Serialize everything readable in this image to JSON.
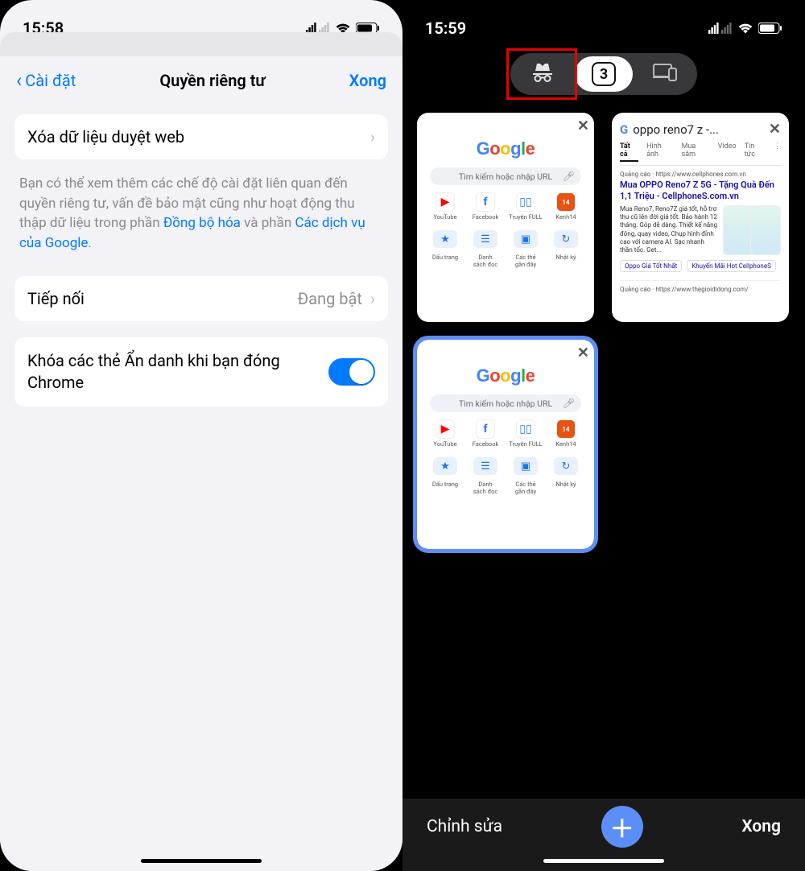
{
  "left": {
    "status_time": "15:58",
    "nav": {
      "back_label": "Cài đặt",
      "title": "Quyền riêng tư",
      "done": "Xong"
    },
    "row_clear_data": "Xóa dữ liệu duyệt web",
    "info": {
      "prefix": "Bạn có thể xem thêm các chế độ cài đặt liên quan đến quyền riêng tư, vấn đề bảo mật cũng như hoạt động thu thập dữ liệu trong phần ",
      "link1": "Đồng bộ hóa",
      "mid": " và phần ",
      "link2": "Các dịch vụ của Google",
      "suffix": "."
    },
    "row_handoff": {
      "title": "Tiếp nối",
      "value": "Đang bật"
    },
    "row_lock": {
      "title": "Khóa các thẻ Ẩn danh khi bạn đóng Chrome",
      "on": true
    }
  },
  "right": {
    "status_time": "15:59",
    "switcher": {
      "tab_count": "3"
    },
    "cards": {
      "google_search_placeholder": "Tìm kiếm hoặc nhập URL",
      "tiles": [
        {
          "label": "YouTube"
        },
        {
          "label": "Facebook"
        },
        {
          "label": "Truyện FULL"
        },
        {
          "label": "Kenh14"
        }
      ],
      "chips": [
        {
          "label": "Dấu trang"
        },
        {
          "label": "Danh\nsách đọc"
        },
        {
          "label": "Các thẻ\ngần đây"
        },
        {
          "label": "Nhật ký"
        }
      ],
      "serp": {
        "title_bar": "oppo reno7 z -...",
        "tabs": [
          "Tất cả",
          "Hình ảnh",
          "Mua sắm",
          "Video",
          "Tin tức"
        ],
        "ad_label": "Quảng cáo · https://www.cellphones.com.vn",
        "headline": "Mua OPPO Reno7 Z 5G - Tặng Quà Đến 1,1 Triệu - CellphoneS.com.vn",
        "desc": "Mua Reno7, Reno7Z giá tốt, hỗ trợ thu cũ lên đời giá tốt. Bảo hành 12 tháng. Góp dễ dàng. Thiết kế năng động, quay video, Chụp hình đỉnh cao với camera AI. Sạc nhanh thần tốc. Get...",
        "chip1": "Oppo Giá Tốt Nhất",
        "chip2": "Khuyến Mãi Hot CellphoneS",
        "ad2_label": "Quảng cáo · https://www.thegioididong.com/"
      }
    },
    "bottom": {
      "edit": "Chỉnh sửa",
      "done": "Xong"
    }
  }
}
